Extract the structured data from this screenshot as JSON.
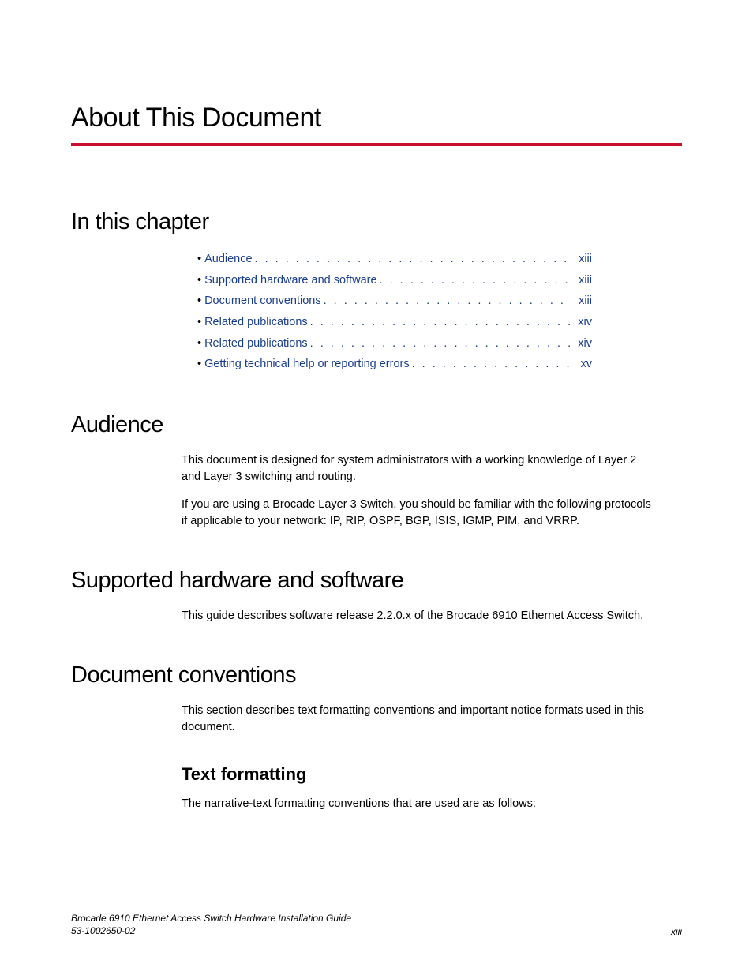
{
  "title": "About This Document",
  "sections": {
    "in_this_chapter": "In this chapter",
    "audience": {
      "heading": "Audience",
      "p1": "This document is designed for system administrators with a working knowledge of Layer 2 and Layer 3 switching and routing.",
      "p2": "If you are using a Brocade Layer 3 Switch, you should be familiar with the following protocols if applicable to your network: IP, RIP, OSPF, BGP, ISIS, IGMP, PIM, and VRRP."
    },
    "supported": {
      "heading": "Supported hardware and software",
      "p1": "This guide describes software release 2.2.0.x of the Brocade 6910 Ethernet Access Switch."
    },
    "conventions": {
      "heading": "Document conventions",
      "p1": "This section describes text formatting conventions and important notice formats used in this document.",
      "sub_heading": "Text formatting",
      "p2": "The narrative-text formatting conventions that are used are as follows:"
    }
  },
  "toc": [
    {
      "label": "Audience",
      "page": "xiii"
    },
    {
      "label": "Supported hardware and software",
      "page": "xiii"
    },
    {
      "label": "Document conventions",
      "page": "xiii"
    },
    {
      "label": "Related publications",
      "page": "xiv"
    },
    {
      "label": "Related publications",
      "page": "xiv"
    },
    {
      "label": "Getting technical help or reporting errors",
      "page": "xv"
    }
  ],
  "footer": {
    "line1": "Brocade 6910 Ethernet Access Switch Hardware Installation Guide",
    "line2": "53-1002650-02",
    "page": "xiii"
  }
}
